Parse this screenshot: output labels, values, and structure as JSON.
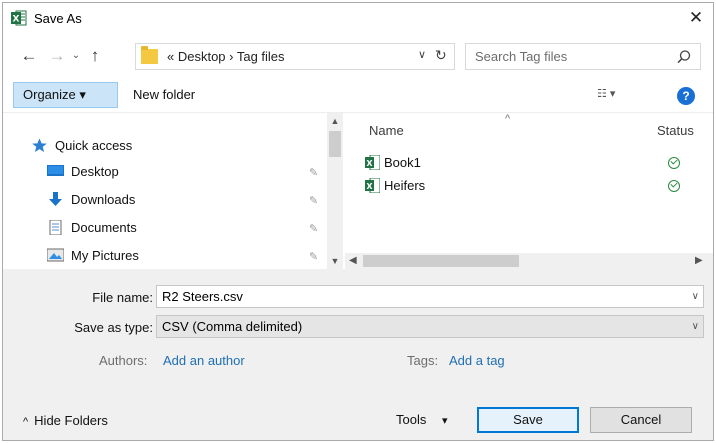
{
  "window": {
    "title": "Save As",
    "close_glyph": "✕"
  },
  "nav": {
    "back_glyph": "←",
    "forward_glyph": "→",
    "recent_glyph": "⌄",
    "up_glyph": "↑",
    "address": "«  Desktop  ›  Tag files",
    "address_dropdown_glyph": "∨",
    "refresh_glyph": "↻",
    "search_placeholder": "Search Tag files"
  },
  "toolbar": {
    "organize_label": "Organize ▾",
    "new_folder_label": "New folder",
    "view_glyph": "☷ ▾",
    "help_glyph": "?"
  },
  "sidebar": {
    "items": [
      {
        "label": "Quick access",
        "icon": "star-icon"
      },
      {
        "label": "Desktop",
        "icon": "desktop-icon"
      },
      {
        "label": "Downloads",
        "icon": "download-icon"
      },
      {
        "label": "Documents",
        "icon": "document-icon"
      },
      {
        "label": "My Pictures",
        "icon": "pictures-icon"
      }
    ],
    "pin_glyph": "✎"
  },
  "files": {
    "columns": {
      "name": "Name",
      "status": "Status",
      "sort_glyph": "^"
    },
    "rows": [
      {
        "name": "Book1",
        "icon": "excel-file-icon",
        "status": "synced"
      },
      {
        "name": "Heifers",
        "icon": "excel-file-icon",
        "status": "synced"
      }
    ]
  },
  "form": {
    "file_name_label": "File name:",
    "file_name_value": "R2 Steers.csv",
    "save_type_label": "Save as type:",
    "save_type_value": "CSV (Comma delimited)",
    "authors_label": "Authors:",
    "authors_link": "Add an author",
    "tags_label": "Tags:",
    "tags_link": "Add a tag",
    "hide_folders_label": "Hide Folders",
    "hide_folders_glyph": "^",
    "tools_label": "Tools",
    "tools_glyph": "▾",
    "save_label": "Save",
    "cancel_label": "Cancel",
    "dropdown_glyph": "∨"
  },
  "colors": {
    "excel_green": "#217346",
    "folder_yellow": "#f5c842",
    "accent_blue": "#0078d7",
    "link_blue": "#1f6fb2",
    "status_green": "#2b8a3e"
  }
}
